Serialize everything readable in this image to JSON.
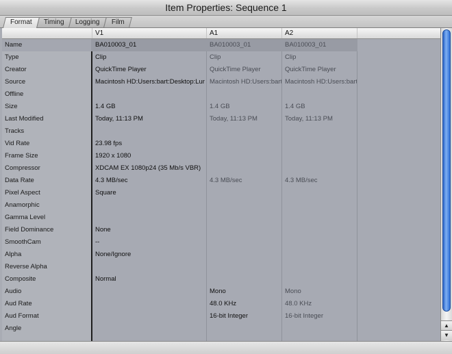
{
  "window": {
    "title": "Item Properties: Sequence 1"
  },
  "tabs": [
    {
      "label": "Format",
      "active": true
    },
    {
      "label": "Timing",
      "active": false
    },
    {
      "label": "Logging",
      "active": false
    },
    {
      "label": "Film",
      "active": false
    }
  ],
  "columns": {
    "v1": "V1",
    "a1": "A1",
    "a2": "A2"
  },
  "rows": [
    {
      "label": "Name",
      "v1": "BA010003_01",
      "a1": "BA010003_01",
      "a2": "BA010003_01"
    },
    {
      "label": "Type",
      "v1": "Clip",
      "a1": "Clip",
      "a2": "Clip"
    },
    {
      "label": "Creator",
      "v1": "QuickTime Player",
      "a1": "QuickTime Player",
      "a2": "QuickTime Player"
    },
    {
      "label": "Source",
      "v1": "Macintosh HD:Users:bart:Desktop:Lur",
      "a1": "Macintosh HD:Users:bart",
      "a2": "Macintosh HD:Users:bart"
    },
    {
      "label": "Offline",
      "v1": "",
      "a1": "",
      "a2": ""
    },
    {
      "label": "Size",
      "v1": "1.4 GB",
      "a1": "1.4 GB",
      "a2": "1.4 GB"
    },
    {
      "label": "Last Modified",
      "v1": "Today, 11:13 PM",
      "a1": "Today, 11:13 PM",
      "a2": "Today, 11:13 PM"
    },
    {
      "label": "Tracks",
      "v1": "",
      "a1": "",
      "a2": ""
    },
    {
      "label": "Vid Rate",
      "v1": "23.98 fps",
      "a1": "",
      "a2": ""
    },
    {
      "label": "Frame Size",
      "v1": "1920 x 1080",
      "a1": "",
      "a2": ""
    },
    {
      "label": "Compressor",
      "v1": "XDCAM EX 1080p24 (35 Mb/s VBR)",
      "a1": "",
      "a2": ""
    },
    {
      "label": "Data Rate",
      "v1": "4.3 MB/sec",
      "a1": "4.3 MB/sec",
      "a2": "4.3 MB/sec"
    },
    {
      "label": "Pixel Aspect",
      "v1": "Square",
      "a1": "",
      "a2": ""
    },
    {
      "label": "Anamorphic",
      "v1": "",
      "a1": "",
      "a2": ""
    },
    {
      "label": "Gamma Level",
      "v1": "",
      "a1": "",
      "a2": ""
    },
    {
      "label": "Field Dominance",
      "v1": "None",
      "a1": "",
      "a2": ""
    },
    {
      "label": "SmoothCam",
      "v1": "--",
      "a1": "",
      "a2": ""
    },
    {
      "label": "Alpha",
      "v1": "None/Ignore",
      "a1": "",
      "a2": ""
    },
    {
      "label": "Reverse Alpha",
      "v1": "",
      "a1": "",
      "a2": ""
    },
    {
      "label": "Composite",
      "v1": "Normal",
      "a1": "",
      "a2": ""
    },
    {
      "label": "Audio",
      "v1": "",
      "a1": "Mono",
      "a2": "Mono"
    },
    {
      "label": "Aud Rate",
      "v1": "",
      "a1": "48.0 KHz",
      "a2": "48.0 KHz"
    },
    {
      "label": "Aud Format",
      "v1": "",
      "a1": "16-bit Integer",
      "a2": "16-bit Integer"
    },
    {
      "label": "Angle",
      "v1": "",
      "a1": "",
      "a2": ""
    }
  ],
  "scrollbar": {
    "up_icon": "arrow-up-icon",
    "down_icon": "arrow-down-icon"
  }
}
